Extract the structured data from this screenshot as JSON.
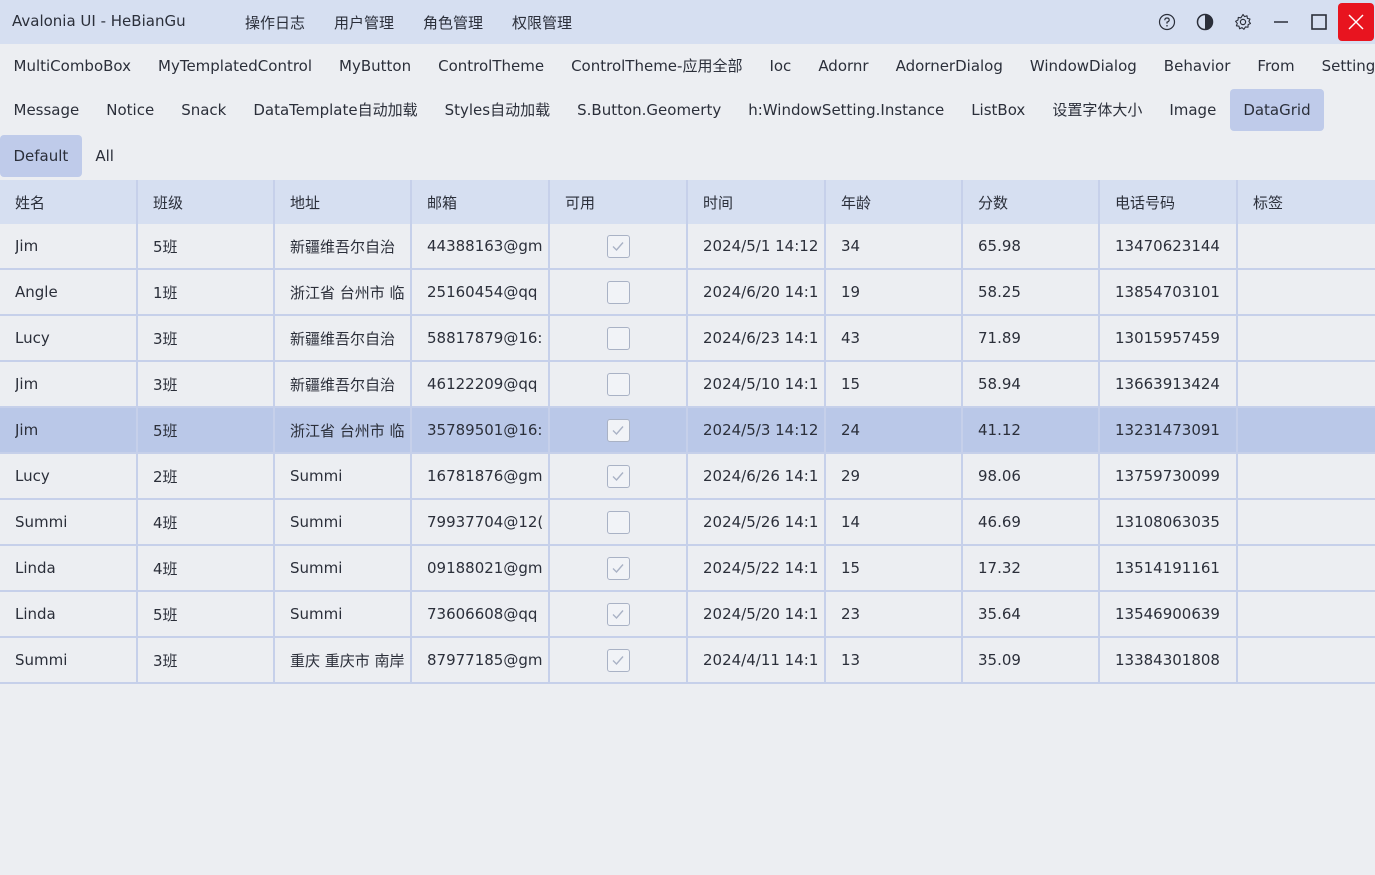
{
  "window": {
    "title": "Avalonia UI - HeBianGu",
    "close_color": "#e8141f"
  },
  "menu": [
    {
      "label": "操作日志"
    },
    {
      "label": "用户管理"
    },
    {
      "label": "角色管理"
    },
    {
      "label": "权限管理"
    }
  ],
  "window_buttons": {
    "icons": [
      "help-icon",
      "theme-icon",
      "settings-icon",
      "minimize-icon",
      "maximize-icon",
      "close-icon"
    ]
  },
  "nav_row1": [
    {
      "label": "MultiComboBox"
    },
    {
      "label": "MyTemplatedControl"
    },
    {
      "label": "MyButton"
    },
    {
      "label": "ControlTheme"
    },
    {
      "label": "ControlTheme-应用全部"
    },
    {
      "label": "Ioc"
    },
    {
      "label": "Adornr"
    },
    {
      "label": "AdornerDialog"
    },
    {
      "label": "WindowDialog"
    },
    {
      "label": "Behavior"
    },
    {
      "label": "From"
    },
    {
      "label": "Setting"
    }
  ],
  "nav_row2": [
    {
      "label": "Message"
    },
    {
      "label": "Notice"
    },
    {
      "label": "Snack"
    },
    {
      "label": "DataTemplate自动加载"
    },
    {
      "label": "Styles自动加载"
    },
    {
      "label": "S.Button.Geomerty"
    },
    {
      "label": "h:WindowSetting.Instance"
    },
    {
      "label": "ListBox"
    },
    {
      "label": "设置字体大小"
    },
    {
      "label": "Image"
    },
    {
      "label": "DataGrid",
      "active": true
    }
  ],
  "nav_row3": [
    {
      "label": "Default",
      "active": true
    },
    {
      "label": "All"
    }
  ],
  "grid": {
    "columns": [
      "姓名",
      "班级",
      "地址",
      "邮箱",
      "可用",
      "时间",
      "年龄",
      "分数",
      "电话号码",
      "标签"
    ],
    "selected_row": 4,
    "rows": [
      {
        "name": "Jim",
        "class": "5班",
        "address": "新疆维吾尔自治",
        "email": "44388163@gm",
        "enabled": true,
        "time": "2024/5/1 14:12",
        "age": "34",
        "score": "65.98",
        "phone": "13470623144",
        "tag": ""
      },
      {
        "name": "Angle",
        "class": "1班",
        "address": "浙江省 台州市 临",
        "email": "25160454@qq",
        "enabled": false,
        "time": "2024/6/20 14:1",
        "age": "19",
        "score": "58.25",
        "phone": "13854703101",
        "tag": ""
      },
      {
        "name": "Lucy",
        "class": "3班",
        "address": "新疆维吾尔自治",
        "email": "58817879@16:",
        "enabled": false,
        "time": "2024/6/23 14:1",
        "age": "43",
        "score": "71.89",
        "phone": "13015957459",
        "tag": ""
      },
      {
        "name": "Jim",
        "class": "3班",
        "address": "新疆维吾尔自治",
        "email": "46122209@qq",
        "enabled": false,
        "time": "2024/5/10 14:1",
        "age": "15",
        "score": "58.94",
        "phone": "13663913424",
        "tag": ""
      },
      {
        "name": "Jim",
        "class": "5班",
        "address": "浙江省 台州市 临",
        "email": "35789501@16:",
        "enabled": true,
        "time": "2024/5/3 14:12",
        "age": "24",
        "score": "41.12",
        "phone": "13231473091",
        "tag": ""
      },
      {
        "name": "Lucy",
        "class": "2班",
        "address": "Summi",
        "email": "16781876@gm",
        "enabled": true,
        "time": "2024/6/26 14:1",
        "age": "29",
        "score": "98.06",
        "phone": "13759730099",
        "tag": ""
      },
      {
        "name": "Summi",
        "class": "4班",
        "address": "Summi",
        "email": "79937704@12(",
        "enabled": false,
        "time": "2024/5/26 14:1",
        "age": "14",
        "score": "46.69",
        "phone": "13108063035",
        "tag": ""
      },
      {
        "name": "Linda",
        "class": "4班",
        "address": "Summi",
        "email": "09188021@gm",
        "enabled": true,
        "time": "2024/5/22 14:1",
        "age": "15",
        "score": "17.32",
        "phone": "13514191161",
        "tag": ""
      },
      {
        "name": "Linda",
        "class": "5班",
        "address": "Summi",
        "email": "73606608@qq",
        "enabled": true,
        "time": "2024/5/20 14:1",
        "age": "23",
        "score": "35.64",
        "phone": "13546900639",
        "tag": ""
      },
      {
        "name": "Summi",
        "class": "3班",
        "address": "重庆 重庆市 南岸",
        "email": "87977185@gm",
        "enabled": true,
        "time": "2024/4/11 14:1",
        "age": "13",
        "score": "35.09",
        "phone": "13384301808",
        "tag": ""
      }
    ]
  }
}
